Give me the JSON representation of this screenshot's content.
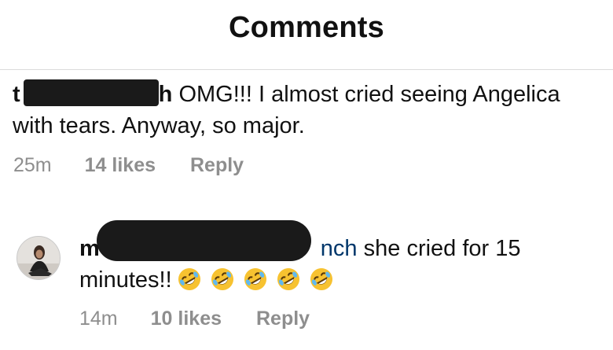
{
  "header": {
    "title": "Comments"
  },
  "comments": [
    {
      "username_prefix": "t",
      "username_suffix": "h",
      "text_line1": "OMG!!! I almost cried seeing Angelica",
      "text_line2": "with tears. Anyway, so major.",
      "time": "25m",
      "likes": "14 likes",
      "reply": "Reply"
    },
    {
      "username_prefix": "m",
      "mention_suffix": "nch",
      "text_line1": "she cried for 15",
      "text_line2": "minutes!!",
      "emoji_icon": "rolling-on-floor-laughing-emoji",
      "emoji_count": 5,
      "time": "14m",
      "likes": "10 likes",
      "reply": "Reply"
    }
  ],
  "colors": {
    "text": "#111111",
    "meta": "#8e8e8e",
    "mention": "#00376b",
    "divider": "#dbdbdb",
    "redaction": "#1a1a1a"
  }
}
